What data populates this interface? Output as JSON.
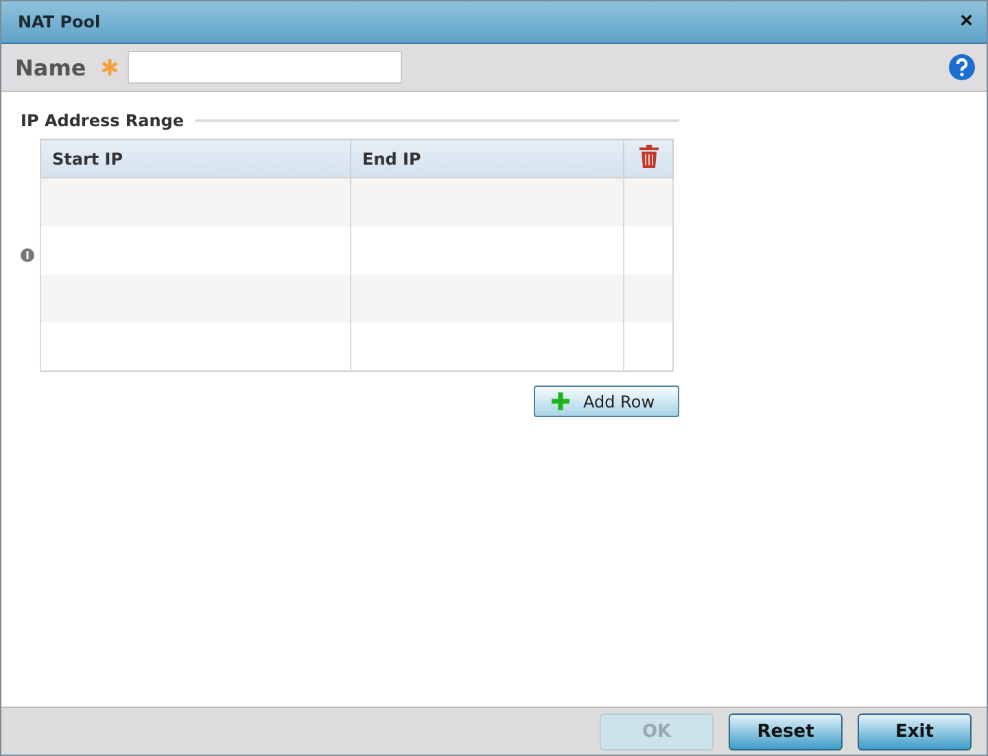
{
  "window": {
    "title": "NAT Pool",
    "close": "×"
  },
  "name_field": {
    "label": "Name",
    "required": true
  },
  "ip_range": {
    "legend": "IP Address Range",
    "columns": [
      "Start IP",
      "End IP"
    ],
    "add_button": "Add Row"
  },
  "buttons": [
    {
      "label": "OK",
      "disabled": true
    },
    {
      "label": "Reset",
      "disabled": false
    },
    {
      "label": "Exit",
      "disabled": false
    }
  ]
}
